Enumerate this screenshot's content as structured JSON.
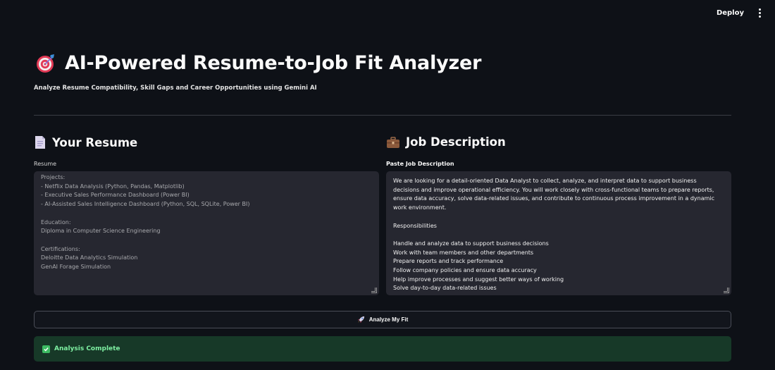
{
  "topbar": {
    "deploy_label": "Deploy"
  },
  "header": {
    "title": "AI-Powered Resume-to-Job Fit Analyzer",
    "subtitle": "Analyze Resume Compatibility, Skill Gaps and Career Opportunities using Gemini AI"
  },
  "resume_section": {
    "title": "Your Resume",
    "label": "Resume",
    "value": "Projects:\n- Netflix Data Analysis (Python, Pandas, Matplotlib)\n- Executive Sales Performance Dashboard (Power BI)\n- AI-Assisted Sales Intelligence Dashboard (Python, SQL, SQLite, Power BI)\n\nEducation:\nDiploma in Computer Science Engineering\n\nCertifications:\nDeloitte Data Analytics Simulation\nGenAI Forage Simulation"
  },
  "job_section": {
    "title": "Job Description",
    "label": "Paste Job Description",
    "value": "We are looking for a detail-oriented Data Analyst to collect, analyze, and interpret data to support business decisions and improve operational efficiency. You will work closely with cross-functional teams to prepare reports, ensure data accuracy, solve data-related issues, and contribute to continuous process improvement in a dynamic work environment.\n\nResponsibilities\n\nHandle and analyze data to support business decisions\nWork with team members and other departments\nPrepare reports and track performance\nFollow company policies and ensure data accuracy\nHelp improve processes and suggest better ways of working\nSolve day-to-day data-related issues"
  },
  "analyze_button": {
    "label": "Analyze My Fit"
  },
  "status": {
    "message": "Analysis Complete"
  },
  "colors": {
    "background": "#0e1117",
    "input_bg": "#262730",
    "success_bg": "#173928",
    "success_text": "#7ef0a2"
  },
  "icons": {
    "title": "target-dart-icon",
    "resume": "document-icon",
    "job": "briefcase-icon",
    "button": "rocket-icon",
    "status": "check-icon",
    "menu": "more-vertical-icon"
  }
}
